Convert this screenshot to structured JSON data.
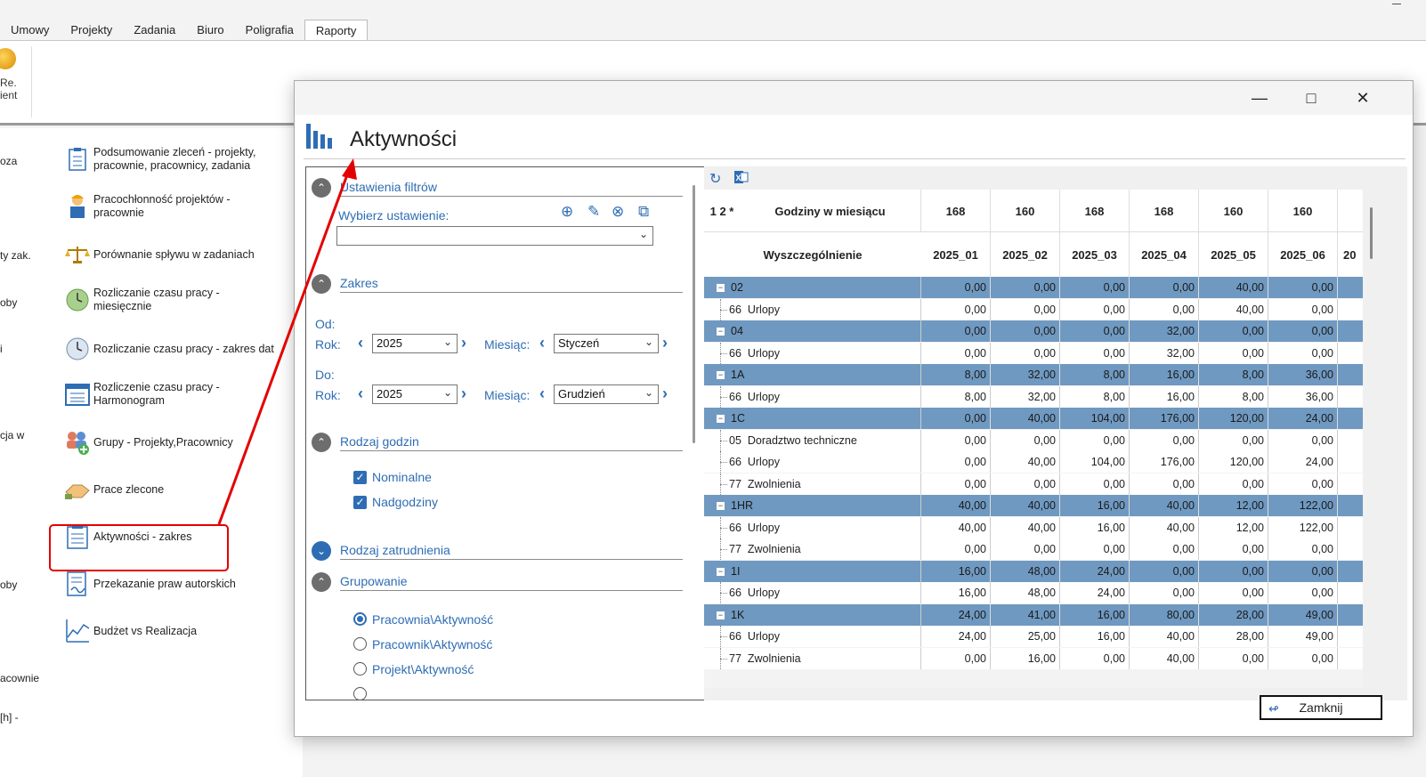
{
  "menu": {
    "tabs": [
      "Umowy",
      "Projekty",
      "Zadania",
      "Biuro",
      "Poligrafia",
      "Raporty"
    ],
    "active_tab": "Raporty"
  },
  "ribbon": {
    "label_line1": "Re.",
    "label_line2": "ient"
  },
  "left_cut": [
    "oza",
    "ty zak.",
    "oby",
    "i",
    "cja w",
    "oby",
    "acownie",
    "[h] -"
  ],
  "reports": [
    {
      "l1": "Podsumowanie zleceń - projekty,",
      "l2": "pracownie, pracownicy, zadania",
      "icon": "clipboard-list-icon"
    },
    {
      "l1": "Pracochłonność projektów -",
      "l2": "pracownie",
      "icon": "worker-icon"
    },
    {
      "l1": "Porównanie spływu w zadaniach",
      "l2": "",
      "icon": "scales-icon"
    },
    {
      "l1": "Rozliczanie czasu pracy -",
      "l2": "miesięcznie",
      "icon": "clock-green-icon"
    },
    {
      "l1": "Rozliczanie czasu pracy - zakres dat",
      "l2": "",
      "icon": "clock-icon"
    },
    {
      "l1": "Rozliczenie czasu pracy -",
      "l2": "Harmonogram",
      "icon": "calendar-icon"
    },
    {
      "l1": "Grupy - Projekty,Pracownicy",
      "l2": "",
      "icon": "group-add-icon"
    },
    {
      "l1": "Prace zlecone",
      "l2": "",
      "icon": "handshake-icon"
    },
    {
      "l1": "Aktywności - zakres",
      "l2": "",
      "icon": "activity-list-icon"
    },
    {
      "l1": "Przekazanie praw autorskich",
      "l2": "",
      "icon": "document-sign-icon"
    },
    {
      "l1": "Budżet vs Realizacja",
      "l2": "",
      "icon": "chart-line-icon"
    }
  ],
  "dialog": {
    "title": "Aktywności",
    "filters": {
      "section1": "Ustawienia filtrów",
      "choose_label": "Wybierz ustawienie:",
      "choose_value": "",
      "section2": "Zakres",
      "od": "Od:",
      "do": "Do:",
      "rok": "Rok:",
      "miesiac": "Miesiąc:",
      "od_rok": "2025",
      "od_miesiac": "Styczeń",
      "do_rok": "2025",
      "do_miesiac": "Grudzień",
      "section3": "Rodzaj godzin",
      "nominalne": "Nominalne",
      "nadgodziny": "Nadgodziny",
      "section4": "Rodzaj zatrudnienia",
      "section5": "Grupowanie",
      "grp_options": [
        "Pracownia\\Aktywność",
        "Pracownik\\Aktywność",
        "Projekt\\Aktywność"
      ],
      "grp_selected": 0
    },
    "grid": {
      "levels": "1 2 *",
      "hours_label": "Godziny w miesiącu",
      "hours": [
        "168",
        "160",
        "168",
        "168",
        "160",
        "160"
      ],
      "desc_label": "Wyszczególnienie",
      "months": [
        "2025_01",
        "2025_02",
        "2025_03",
        "2025_04",
        "2025_05",
        "2025_06",
        "20"
      ],
      "rows": [
        {
          "t": "g",
          "n": "02",
          "v": [
            "0,00",
            "0,00",
            "0,00",
            "0,00",
            "40,00",
            "0,00"
          ]
        },
        {
          "t": "d",
          "n": "66  Urlopy",
          "v": [
            "0,00",
            "0,00",
            "0,00",
            "0,00",
            "40,00",
            "0,00"
          ]
        },
        {
          "t": "g",
          "n": "04",
          "v": [
            "0,00",
            "0,00",
            "0,00",
            "32,00",
            "0,00",
            "0,00"
          ]
        },
        {
          "t": "d",
          "n": "66  Urlopy",
          "v": [
            "0,00",
            "0,00",
            "0,00",
            "32,00",
            "0,00",
            "0,00"
          ]
        },
        {
          "t": "g",
          "n": "1A",
          "v": [
            "8,00",
            "32,00",
            "8,00",
            "16,00",
            "8,00",
            "36,00"
          ]
        },
        {
          "t": "d",
          "n": "66  Urlopy",
          "v": [
            "8,00",
            "32,00",
            "8,00",
            "16,00",
            "8,00",
            "36,00"
          ]
        },
        {
          "t": "g",
          "n": "1C",
          "v": [
            "0,00",
            "40,00",
            "104,00",
            "176,00",
            "120,00",
            "24,00"
          ]
        },
        {
          "t": "d",
          "n": "05  Doradztwo techniczne",
          "v": [
            "0,00",
            "0,00",
            "0,00",
            "0,00",
            "0,00",
            "0,00"
          ]
        },
        {
          "t": "d",
          "n": "66  Urlopy",
          "v": [
            "0,00",
            "40,00",
            "104,00",
            "176,00",
            "120,00",
            "24,00"
          ]
        },
        {
          "t": "d",
          "n": "77  Zwolnienia",
          "v": [
            "0,00",
            "0,00",
            "0,00",
            "0,00",
            "0,00",
            "0,00"
          ]
        },
        {
          "t": "g",
          "n": "1HR",
          "v": [
            "40,00",
            "40,00",
            "16,00",
            "40,00",
            "12,00",
            "122,00"
          ]
        },
        {
          "t": "d",
          "n": "66  Urlopy",
          "v": [
            "40,00",
            "40,00",
            "16,00",
            "40,00",
            "12,00",
            "122,00"
          ]
        },
        {
          "t": "d",
          "n": "77  Zwolnienia",
          "v": [
            "0,00",
            "0,00",
            "0,00",
            "0,00",
            "0,00",
            "0,00"
          ]
        },
        {
          "t": "g",
          "n": "1I",
          "v": [
            "16,00",
            "48,00",
            "24,00",
            "0,00",
            "0,00",
            "0,00"
          ]
        },
        {
          "t": "d",
          "n": "66  Urlopy",
          "v": [
            "16,00",
            "48,00",
            "24,00",
            "0,00",
            "0,00",
            "0,00"
          ]
        },
        {
          "t": "g",
          "n": "1K",
          "v": [
            "24,00",
            "41,00",
            "16,00",
            "80,00",
            "28,00",
            "49,00"
          ]
        },
        {
          "t": "d",
          "n": "66  Urlopy",
          "v": [
            "24,00",
            "25,00",
            "16,00",
            "40,00",
            "28,00",
            "49,00"
          ]
        },
        {
          "t": "d",
          "n": "77  Zwolnienia",
          "v": [
            "0,00",
            "16,00",
            "0,00",
            "40,00",
            "0,00",
            "0,00"
          ]
        }
      ]
    },
    "close_label": "Zamknij"
  },
  "colors": {
    "accent": "#2e6db4",
    "group_row": "#6f99c1",
    "highlight": "#e30000"
  }
}
